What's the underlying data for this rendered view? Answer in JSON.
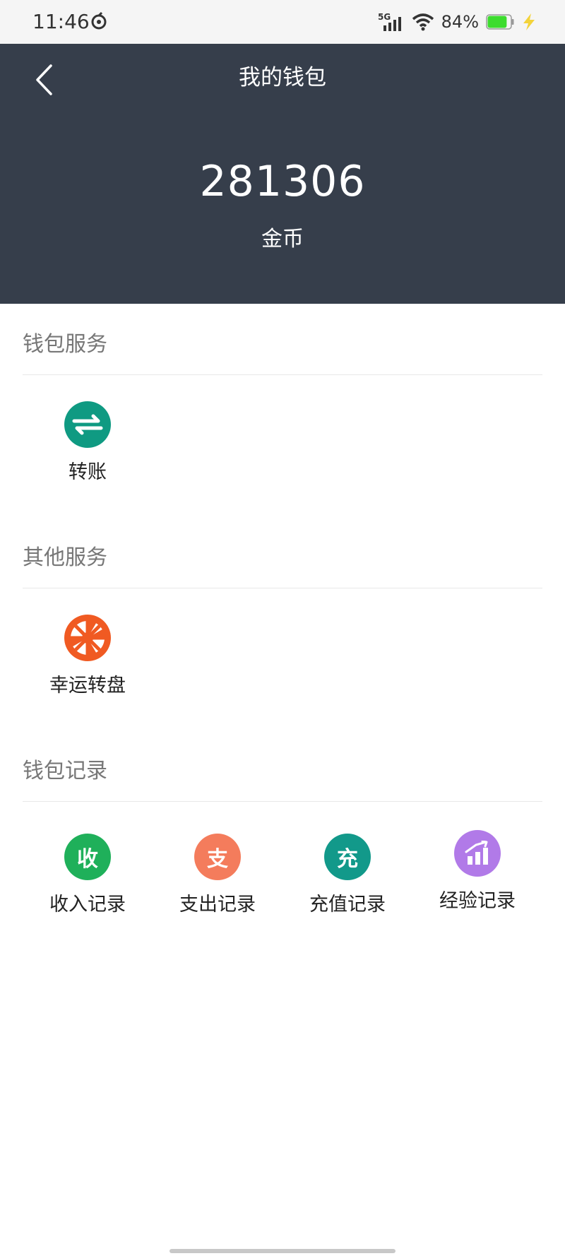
{
  "status_bar": {
    "time": "11:46",
    "network": "5G",
    "battery_percent": "84%",
    "battery_level": 0.84
  },
  "header": {
    "title": "我的钱包",
    "balance": "281306",
    "balance_unit": "金币"
  },
  "sections": {
    "wallet_service": {
      "title": "钱包服务",
      "items": [
        {
          "label": "转账",
          "icon": "transfer-icon",
          "color": "#0f9a82"
        }
      ]
    },
    "other_service": {
      "title": "其他服务",
      "items": [
        {
          "label": "幸运转盘",
          "icon": "lucky-wheel-icon",
          "color": "#f05a22"
        }
      ]
    },
    "wallet_records": {
      "title": "钱包记录",
      "items": [
        {
          "label": "收入记录",
          "icon_text": "收",
          "icon": "income-icon",
          "color": "#1fb05a"
        },
        {
          "label": "支出记录",
          "icon_text": "支",
          "icon": "expense-icon",
          "color": "#f47c5c"
        },
        {
          "label": "充值记录",
          "icon_text": "充",
          "icon": "recharge-icon",
          "color": "#12998a"
        },
        {
          "label": "经验记录",
          "icon": "experience-chart-icon",
          "color": "#b17ae8"
        }
      ]
    }
  },
  "colors": {
    "header_bg": "#363e4b",
    "section_title": "#777777",
    "divider": "#e8e8e8"
  }
}
